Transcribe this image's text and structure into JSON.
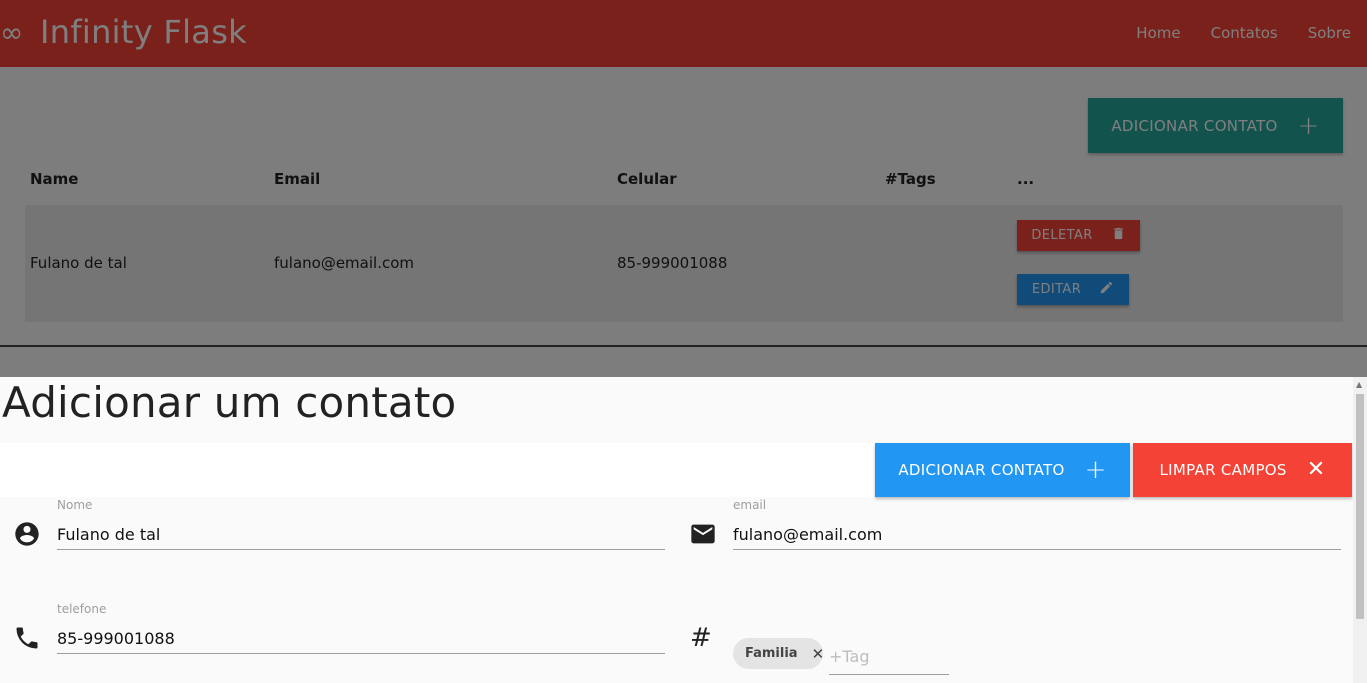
{
  "app": {
    "title": "Infinity Flask",
    "logo_glyph": "∞"
  },
  "nav": {
    "items": [
      "Home",
      "Contatos",
      "Sobre"
    ]
  },
  "contacts": {
    "add_label": "ADICIONAR CONTATO",
    "columns": [
      "Name",
      "Email",
      "Celular",
      "#Tags",
      "..."
    ],
    "rows": [
      {
        "name": "Fulano de tal",
        "email": "fulano@email.com",
        "celular": "85-999001088",
        "tags": ""
      }
    ],
    "delete_label": "DELETAR",
    "edit_label": "EDITAR"
  },
  "modal": {
    "title": "Adicionar um contato",
    "add_label": "ADICIONAR CONTATO",
    "clear_label": "LIMPAR CAMPOS",
    "fields": {
      "nome": {
        "label": "Nome",
        "value": "Fulano de tal"
      },
      "email": {
        "label": "email",
        "value": "fulano@email.com"
      },
      "telefone": {
        "label": "telefone",
        "value": "85-999001088"
      },
      "tags": {
        "chips": [
          "Familia"
        ],
        "placeholder": "+Tag"
      }
    }
  },
  "colors": {
    "primary": "#f44336",
    "teal": "#26a69a",
    "blue": "#2196f3"
  }
}
